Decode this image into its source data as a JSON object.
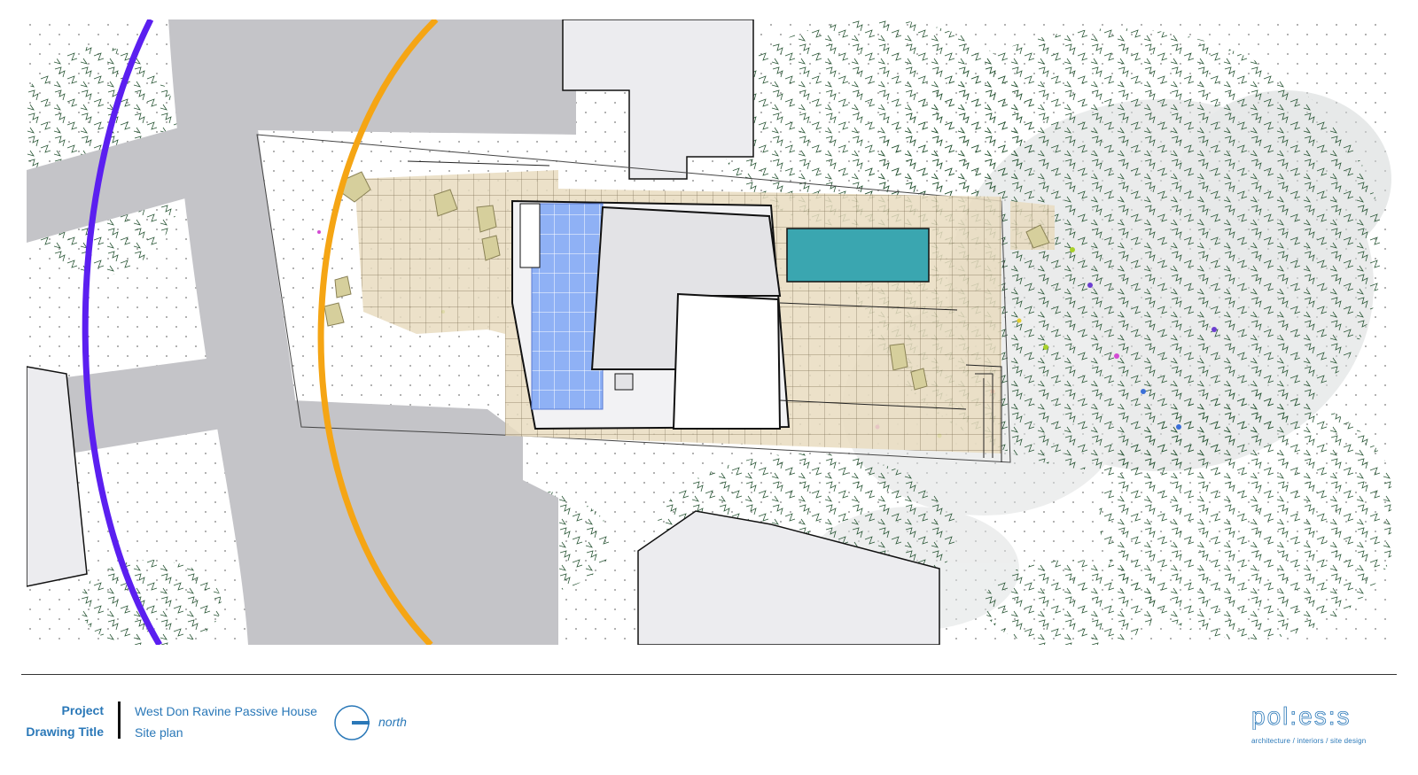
{
  "title_block": {
    "project_label": "Project",
    "project_value": "West Don Ravine Passive House",
    "drawing_title_label": "Drawing Title",
    "drawing_title_value": "Site plan",
    "north_label": "north"
  },
  "logo": {
    "wordmark": "pol:es:s",
    "tagline": "architecture / interiors / site design"
  },
  "colors": {
    "accent_blue": "#2a78b8",
    "purple_arc": "#5b1ff0",
    "orange_arc": "#f5a514",
    "pool": "#3aa6b0",
    "solar_panels": "#8fb1f5",
    "deck": "#e9dcc0",
    "road": "#c4c4c8",
    "building": "#ececef",
    "vegetation": "#1e4d2b"
  }
}
